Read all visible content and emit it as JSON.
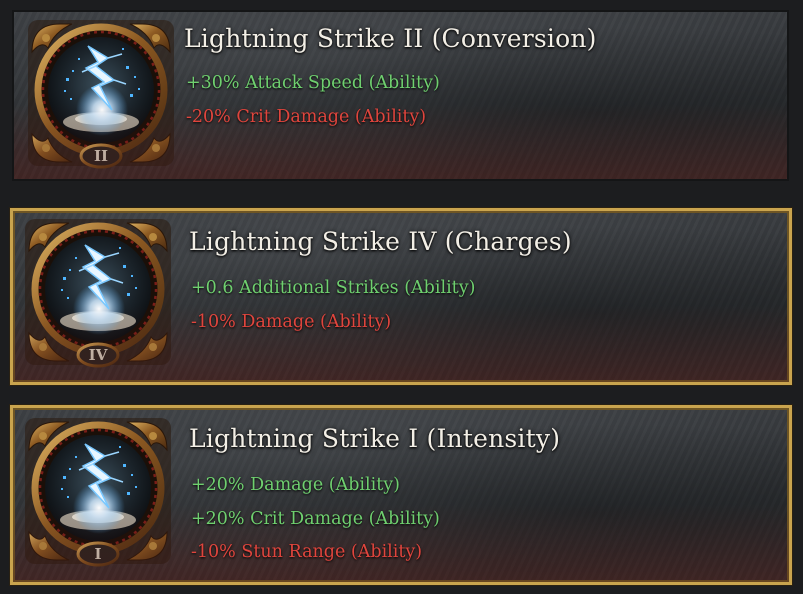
{
  "cards": [
    {
      "title": "Lightning Strike II (Conversion)",
      "numeral": "II",
      "stats": [
        {
          "text": "+30% Attack Speed (Ability)",
          "kind": "buff"
        },
        {
          "text": "-20% Crit Damage (Ability)",
          "kind": "debuff"
        }
      ]
    },
    {
      "title": "Lightning Strike IV (Charges)",
      "numeral": "IV",
      "stats": [
        {
          "text": "+0.6 Additional Strikes (Ability)",
          "kind": "buff"
        },
        {
          "text": "-10% Damage (Ability)",
          "kind": "debuff"
        }
      ]
    },
    {
      "title": "Lightning Strike I (Intensity)",
      "numeral": "I",
      "stats": [
        {
          "text": "+20% Damage (Ability)",
          "kind": "buff"
        },
        {
          "text": "+20% Crit Damage (Ability)",
          "kind": "buff"
        },
        {
          "text": "-10% Stun Range (Ability)",
          "kind": "debuff"
        }
      ]
    }
  ],
  "colors": {
    "buff": "#6fd06f",
    "debuff": "#e0453d",
    "frame_gold": "#c9a44e",
    "title": "#f3efe6"
  },
  "icons": [
    "lightning-strike-icon",
    "ornate-bronze-frame"
  ]
}
